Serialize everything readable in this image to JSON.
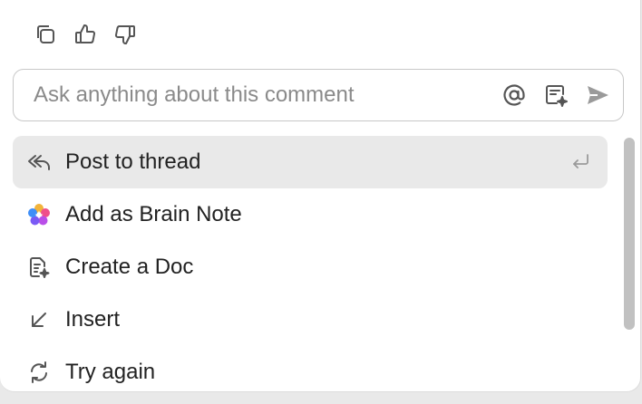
{
  "feedback": {
    "copy_icon": "copy-icon",
    "thumbs_up_icon": "thumbs-up-icon",
    "thumbs_down_icon": "thumbs-down-icon"
  },
  "ask": {
    "placeholder": "Ask anything about this comment",
    "mention_icon": "at-icon",
    "note_icon": "note-sparkle-icon",
    "send_icon": "send-icon"
  },
  "menu": {
    "items": [
      {
        "label": "Post to thread",
        "icon": "reply-icon",
        "hint_icon": "enter-icon"
      },
      {
        "label": "Add as Brain Note",
        "icon": "brain-icon"
      },
      {
        "label": "Create a Doc",
        "icon": "doc-sparkle-icon"
      },
      {
        "label": "Insert",
        "icon": "arrow-down-left-icon"
      },
      {
        "label": "Try again",
        "icon": "retry-icon"
      }
    ]
  },
  "colors": {
    "icon": "#555555",
    "muted_icon": "#9a9a9a",
    "active_bg": "#e9e9e9",
    "border": "#c8c8c8"
  }
}
